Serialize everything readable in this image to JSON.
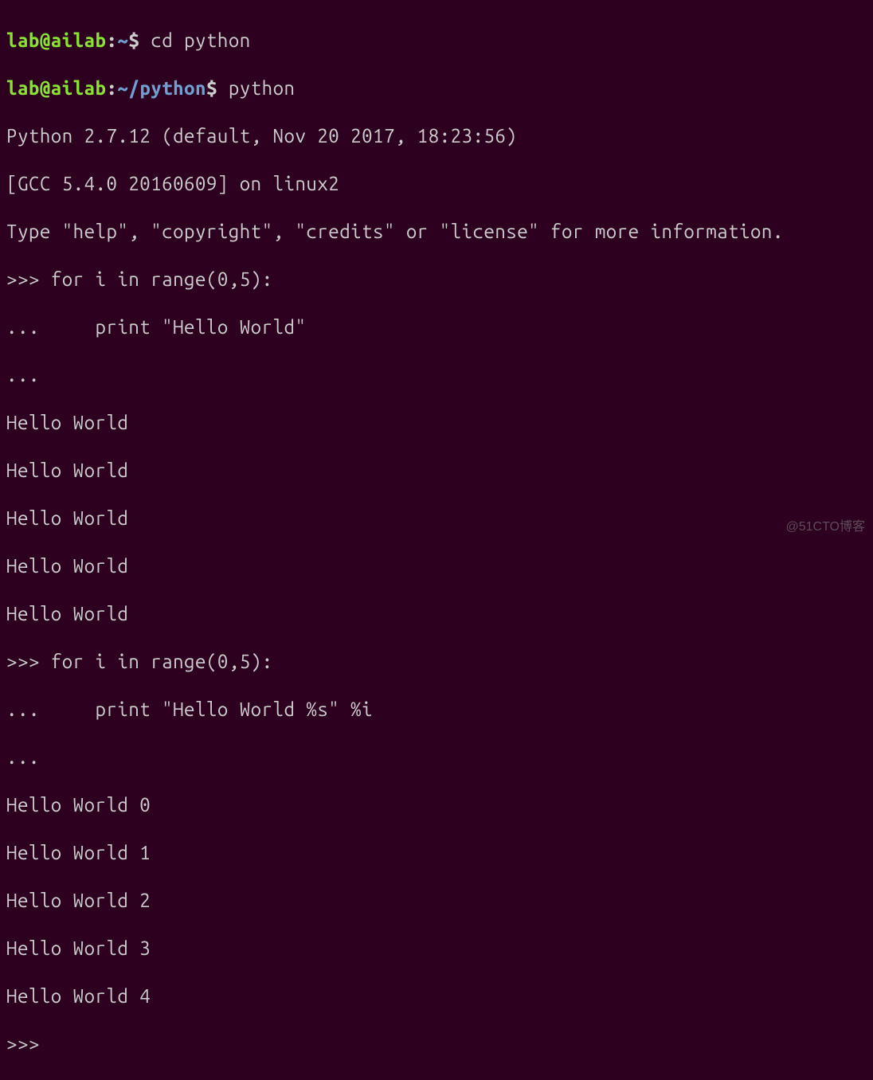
{
  "prompt1": {
    "user": "lab@ailab",
    "sep": ":",
    "path": "~",
    "marker": "$ ",
    "command": "cd python"
  },
  "prompt2": {
    "user": "lab@ailab",
    "sep": ":",
    "tilde": "~",
    "path": "/python",
    "marker": "$ ",
    "command": "python"
  },
  "banner": {
    "line1": "Python 2.7.12 (default, Nov 20 2017, 18:23:56)",
    "line2": "[GCC 5.4.0 20160609] on linux2",
    "line3": "Type \"help\", \"copyright\", \"credits\" or \"license\" for more information."
  },
  "repl1": {
    "l1": ">>> for i in range(0,5):",
    "l2": "...     print \"Hello World\"",
    "l3": "...",
    "out": [
      "Hello World",
      "Hello World",
      "Hello World",
      "Hello World",
      "Hello World"
    ]
  },
  "repl2": {
    "l1": ">>> for i in range(0,5):",
    "l2": "...     print \"Hello World %s\" %i",
    "l3": "...",
    "out": [
      "Hello World 0",
      "Hello World 1",
      "Hello World 2",
      "Hello World 3",
      "Hello World 4"
    ]
  },
  "final_prompt": ">>>",
  "watermark": "@51CTO博客"
}
